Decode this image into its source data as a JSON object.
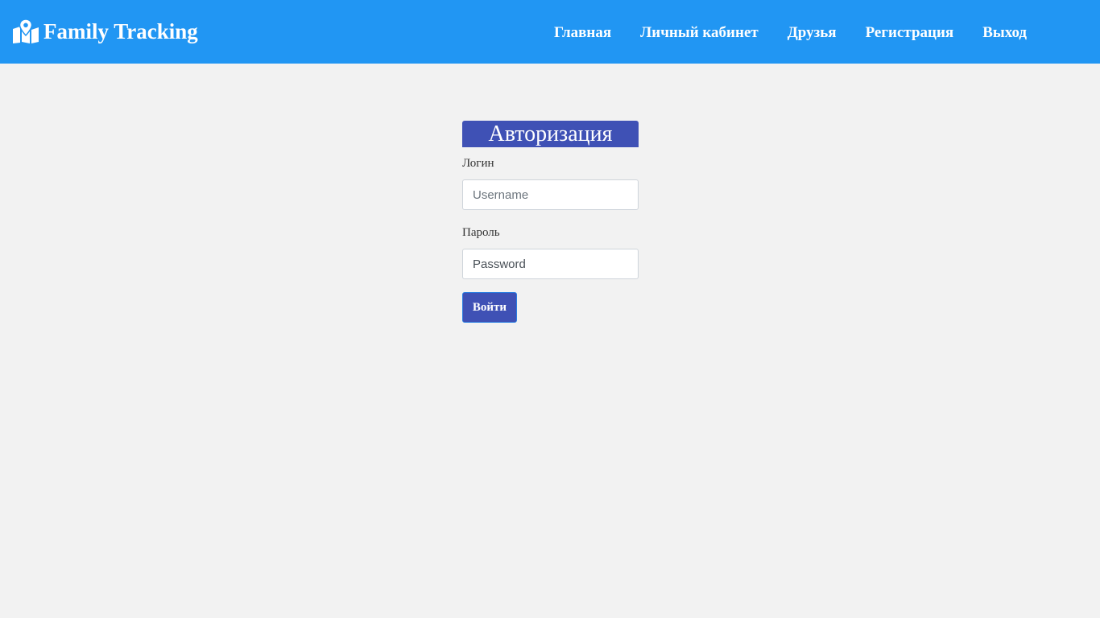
{
  "colors": {
    "navbar_bg": "#2196f3",
    "page_bg": "#f2f2f2",
    "accent": "#3f51b5",
    "text_white": "#ffffff"
  },
  "navbar": {
    "brand": {
      "icon": "map-marker-icon",
      "text": "Family Tracking"
    },
    "links": [
      {
        "label": "Главная"
      },
      {
        "label": "Личный кабинет"
      },
      {
        "label": "Друзья"
      },
      {
        "label": "Регистрация"
      },
      {
        "label": "Выход"
      }
    ]
  },
  "login_form": {
    "title": "Авторизация",
    "username": {
      "label": "Логин",
      "placeholder": "Username",
      "value": ""
    },
    "password": {
      "label": "Пароль",
      "placeholder": "Password",
      "value": ""
    },
    "submit_label": "Войти"
  }
}
